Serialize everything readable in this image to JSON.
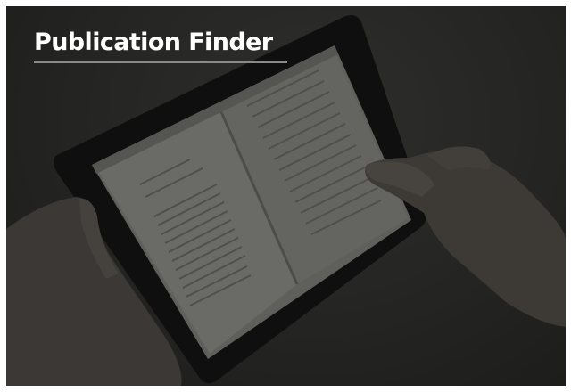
{
  "tile": {
    "title": "Publication Finder",
    "image": {
      "icon": "tablet-ebook-photo"
    },
    "colors": {
      "overlay": "#242422",
      "title": "#ffffff",
      "underline": "#8a8a86"
    }
  }
}
